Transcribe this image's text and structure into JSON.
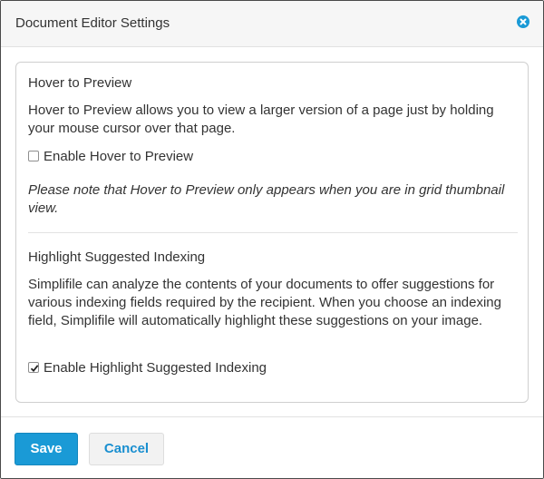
{
  "dialog": {
    "title": "Document Editor Settings",
    "close_icon": "close-circle-icon"
  },
  "hover_preview": {
    "title": "Hover to Preview",
    "description": "Hover to Preview allows you to view a larger version of a page just by holding your mouse cursor over that page.",
    "checkbox_label": "Enable Hover to Preview",
    "checked": false,
    "note": "Please note that Hover to Preview only appears when you are in grid thumbnail view."
  },
  "highlight_indexing": {
    "title": "Highlight Suggested Indexing",
    "description": "Simplifile can analyze the contents of your documents to offer suggestions for various indexing fields required by the recipient. When you choose an indexing field, Simplifile will automatically highlight these suggestions on your image.",
    "checkbox_label": "Enable Highlight Suggested Indexing",
    "checked": true
  },
  "footer": {
    "save_label": "Save",
    "cancel_label": "Cancel"
  },
  "colors": {
    "accent": "#1a9ad6",
    "link": "#1a8fd0",
    "text": "#333333",
    "header_bg": "#f6f6f6"
  }
}
